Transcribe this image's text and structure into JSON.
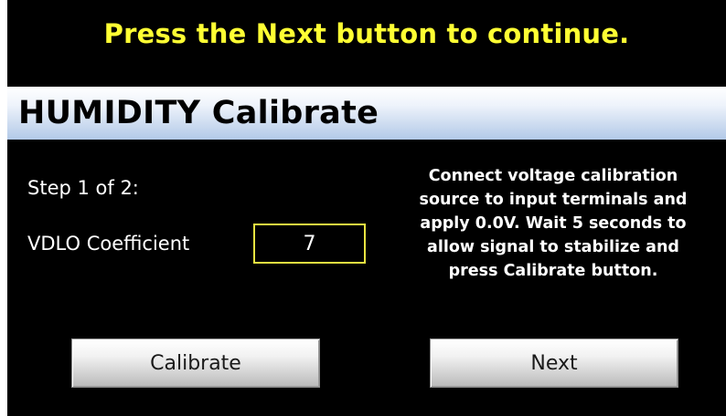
{
  "banner": {
    "message": "Press the Next button to continue."
  },
  "header": {
    "title": "HUMIDITY Calibrate"
  },
  "step": {
    "label": "Step 1 of 2:"
  },
  "coefficient": {
    "label": "VDLO Coefficient",
    "value": "7"
  },
  "instructions": {
    "lines": [
      "Connect voltage calibration",
      "source to input terminals and",
      "apply 0.0V. Wait 5 seconds to",
      "allow signal to stabilize and",
      "press Calibrate button."
    ]
  },
  "buttons": {
    "calibrate_label": "Calibrate",
    "next_label": "Next"
  },
  "colors": {
    "background": "#000000",
    "banner_text": "#ffff33",
    "field_border": "#e8e341",
    "title_bar_top": "#ffffff",
    "title_bar_bottom": "#b2c9e8"
  }
}
